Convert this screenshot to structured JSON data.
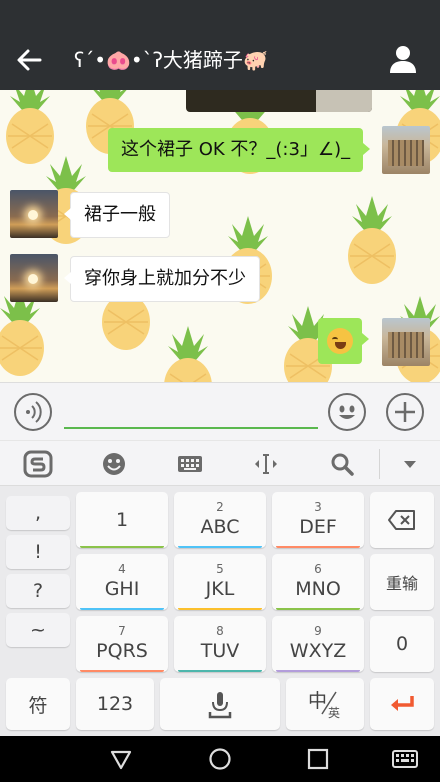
{
  "title_bar": {
    "title_text": "ʕ´•",
    "pig_face": "🐽",
    "title_text_2": "•`ʔ大猪蹄子",
    "pig_emoji": "🐖",
    "back_icon": "arrow-left-icon",
    "profile_icon": "person-icon"
  },
  "messages": [
    {
      "side": "right",
      "text": "这个裙子 OK 不？_(:3」∠)_",
      "avatar": "building"
    },
    {
      "side": "left",
      "text": "裙子一般",
      "avatar": "sunset"
    },
    {
      "side": "left",
      "text": "穿你身上就加分不少",
      "avatar": "sunset"
    },
    {
      "side": "right",
      "emoji": "grinning-sweat-face",
      "avatar": "building"
    }
  ],
  "input_bar": {
    "voice_icon": "voice-icon",
    "emoji_icon": "emoji-icon",
    "plus_icon": "plus-icon",
    "input_value": ""
  },
  "ime_toolbar": {
    "tools": [
      "sogou-logo-icon",
      "emoji-face-icon",
      "keyboard-icon",
      "cursor-move-icon",
      "search-icon",
      "collapse-down-icon"
    ]
  },
  "keyboard": {
    "punctuation": [
      ",",
      "!",
      "?",
      "~"
    ],
    "rows": [
      [
        {
          "num": "",
          "letters": "1"
        },
        {
          "num": "2",
          "letters": "ABC"
        },
        {
          "num": "3",
          "letters": "DEF"
        }
      ],
      [
        {
          "num": "4",
          "letters": "GHI"
        },
        {
          "num": "5",
          "letters": "JKL"
        },
        {
          "num": "6",
          "letters": "MNO"
        }
      ],
      [
        {
          "num": "7",
          "letters": "PQRS"
        },
        {
          "num": "8",
          "letters": "TUV"
        },
        {
          "num": "9",
          "letters": "WXYZ"
        }
      ]
    ],
    "delete_icon": "backspace-icon",
    "reinput_label": "重输",
    "zero_label": "0",
    "symbol_label": "符",
    "num_label": "123",
    "mic_icon": "microphone-icon",
    "lang_main": "中",
    "lang_sub": "英",
    "enter_icon": "enter-icon",
    "underline_colors": [
      "#8bc34a",
      "#4fc3f7",
      "#ff8a65",
      "#fbc02d",
      "#b39ddb",
      "#4db6ac"
    ]
  },
  "nav_bar": {
    "back": "nav-back-icon",
    "home": "nav-home-icon",
    "recents": "nav-recents-icon",
    "keyboard": "nav-keyboard-icon"
  }
}
